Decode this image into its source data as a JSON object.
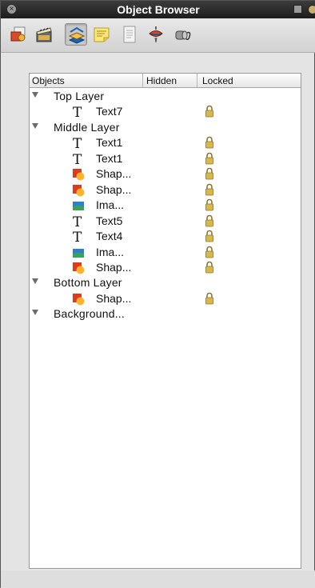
{
  "window": {
    "title": "Object Browser"
  },
  "toolbar": {
    "tools": [
      {
        "icon": "shapes-icon"
      },
      {
        "icon": "clapboard-icon"
      },
      {
        "icon": "layers-icon",
        "active": true
      },
      {
        "icon": "sticky-note-icon"
      },
      {
        "icon": "document-icon"
      },
      {
        "icon": "spinning-top-icon"
      },
      {
        "icon": "paint-roller-icon"
      }
    ]
  },
  "columns": {
    "objects": "Objects",
    "hidden": "Hidden",
    "locked": "Locked"
  },
  "layers": [
    {
      "name": "Top Layer",
      "items": [
        {
          "type": "text",
          "label": "Text7",
          "locked": true
        }
      ]
    },
    {
      "name": "Middle Layer",
      "items": [
        {
          "type": "text",
          "label": "Text1",
          "locked": true
        },
        {
          "type": "text",
          "label": "Text1",
          "locked": true
        },
        {
          "type": "shape",
          "label": "Shap...",
          "locked": true
        },
        {
          "type": "shape",
          "label": "Shap...",
          "locked": true
        },
        {
          "type": "image",
          "label": "Ima...",
          "locked": true
        },
        {
          "type": "text",
          "label": "Text5",
          "locked": true
        },
        {
          "type": "text",
          "label": "Text4",
          "locked": true
        },
        {
          "type": "image",
          "label": "Ima...",
          "locked": true
        },
        {
          "type": "shape",
          "label": "Shap...",
          "locked": true
        }
      ]
    },
    {
      "name": "Bottom Layer",
      "items": [
        {
          "type": "shape",
          "label": "Shap...",
          "locked": true
        }
      ]
    },
    {
      "name": "Background...",
      "items": []
    }
  ],
  "colors": {
    "lock": "#d8b84a",
    "shapeRed": "#e03a1e",
    "shapeOrange": "#ffb22c",
    "imageBlue": "#2f7fd0",
    "imageGreen": "#3aa35a"
  }
}
